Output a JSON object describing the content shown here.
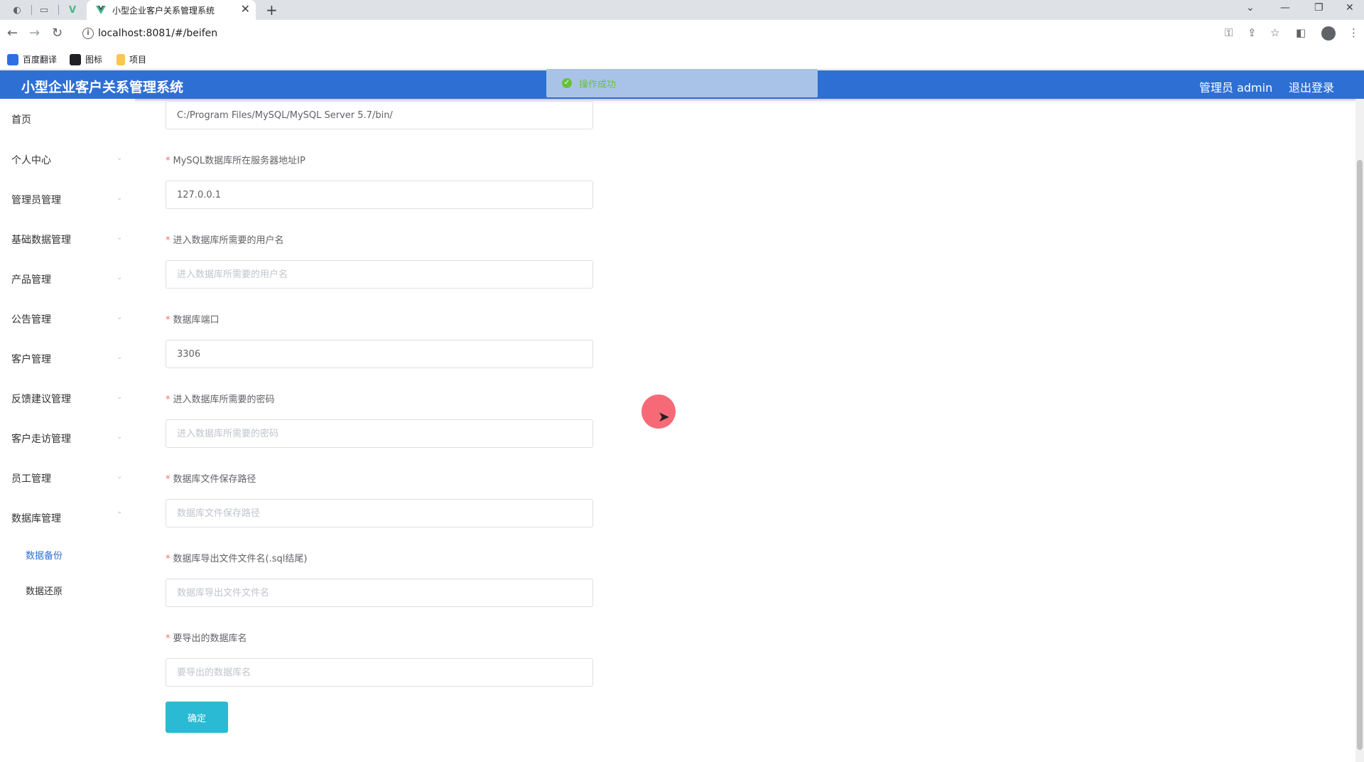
{
  "browser": {
    "tab_title": "小型企业客户关系管理系统",
    "new_tab_symbol": "+",
    "close_symbol": "✕",
    "url": "localhost:8081/#/beifen",
    "bookmarks": [
      {
        "label": "百度翻译",
        "color": "#2d6fe3"
      },
      {
        "label": "图标",
        "color": "#202124"
      },
      {
        "label": "项目",
        "color": "#f9c74f"
      }
    ]
  },
  "header": {
    "title": "小型企业客户关系管理系统",
    "user_label": "管理员 admin",
    "logout_label": "退出登录",
    "bg_color": "#2e6fd3"
  },
  "toast": {
    "message": "操作成功",
    "status": "success"
  },
  "sidebar": {
    "items": [
      {
        "label": "首页"
      },
      {
        "label": "个人中心"
      },
      {
        "label": "管理员管理"
      },
      {
        "label": "基础数据管理"
      },
      {
        "label": "产品管理"
      },
      {
        "label": "公告管理"
      },
      {
        "label": "客户管理"
      },
      {
        "label": "反馈建议管理"
      },
      {
        "label": "客户走访管理"
      },
      {
        "label": "员工管理"
      },
      {
        "label": "数据库管理"
      }
    ],
    "subitems": [
      {
        "label": "数据备份",
        "active": true
      },
      {
        "label": "数据还原",
        "active": false
      }
    ]
  },
  "form": {
    "required_mark": "*",
    "install_path": {
      "value": "C:/Program Files/MySQL/MySQL Server 5.7/bin/"
    },
    "server_ip": {
      "label": "MySQL数据库所在服务器地址IP",
      "value": "127.0.0.1"
    },
    "username": {
      "label": "进入数据库所需要的用户名",
      "placeholder": "进入数据库所需要的用户名",
      "value": ""
    },
    "port": {
      "label": "数据库端口",
      "value": "3306"
    },
    "password": {
      "label": "进入数据库所需要的密码",
      "placeholder": "进入数据库所需要的密码",
      "value": ""
    },
    "save_path": {
      "label": "数据库文件保存路径",
      "placeholder": "数据库文件保存路径",
      "value": ""
    },
    "export_filename": {
      "label": "数据库导出文件文件名(.sql结尾)",
      "placeholder": "数据库导出文件文件名",
      "value": ""
    },
    "database_name": {
      "label": "要导出的数据库名",
      "placeholder": "要导出的数据库名",
      "value": ""
    },
    "submit_label": "确定"
  }
}
